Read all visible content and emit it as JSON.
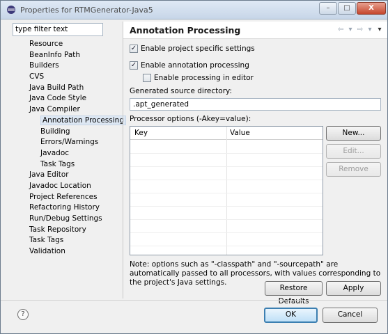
{
  "window": {
    "title": "Properties for RTMGenerator-Java5",
    "controls": {
      "minimize": "–",
      "maximize": "□",
      "close": "X"
    }
  },
  "sidebar": {
    "filter_value": "type filter text",
    "items": [
      {
        "label": "Resource",
        "level": 0
      },
      {
        "label": "BeanInfo Path",
        "level": 0
      },
      {
        "label": "Builders",
        "level": 0
      },
      {
        "label": "CVS",
        "level": 0
      },
      {
        "label": "Java Build Path",
        "level": 0
      },
      {
        "label": "Java Code Style",
        "level": 0
      },
      {
        "label": "Java Compiler",
        "level": 0
      },
      {
        "label": "Annotation Processing",
        "level": 1,
        "selected": true
      },
      {
        "label": "Building",
        "level": 1
      },
      {
        "label": "Errors/Warnings",
        "level": 1
      },
      {
        "label": "Javadoc",
        "level": 1
      },
      {
        "label": "Task Tags",
        "level": 1
      },
      {
        "label": "Java Editor",
        "level": 0
      },
      {
        "label": "Javadoc Location",
        "level": 0
      },
      {
        "label": "Project References",
        "level": 0
      },
      {
        "label": "Refactoring History",
        "level": 0
      },
      {
        "label": "Run/Debug Settings",
        "level": 0
      },
      {
        "label": "Task Repository",
        "level": 0
      },
      {
        "label": "Task Tags",
        "level": 0
      },
      {
        "label": "Validation",
        "level": 0
      }
    ]
  },
  "page": {
    "title": "Annotation Processing",
    "enable_project_specific": {
      "label": "Enable project specific settings",
      "checked": true
    },
    "enable_annotation_processing": {
      "label": "Enable annotation processing",
      "checked": true
    },
    "enable_processing_in_editor": {
      "label": "Enable processing in editor",
      "checked": false
    },
    "generated_dir_label": "Generated source directory:",
    "generated_dir_value": ".apt_generated",
    "processor_options_label": "Processor options (-Akey=value):",
    "table": {
      "columns": [
        "Key",
        "Value"
      ],
      "rows": []
    },
    "buttons": {
      "new": "New...",
      "edit": "Edit...",
      "remove": "Remove"
    },
    "note": "Note: options such as \"-classpath\" and \"-sourcepath\" are automatically passed to all processors, with values corresponding to the project's Java settings.",
    "restore_defaults": "Restore Defaults",
    "apply": "Apply"
  },
  "footer": {
    "help_icon": "question-icon",
    "help_symbol": "?",
    "ok": "OK",
    "cancel": "Cancel"
  },
  "colors": {
    "accent": "#3c7fb1",
    "selection": "#dde7f3",
    "background": "#f0f0f0"
  }
}
